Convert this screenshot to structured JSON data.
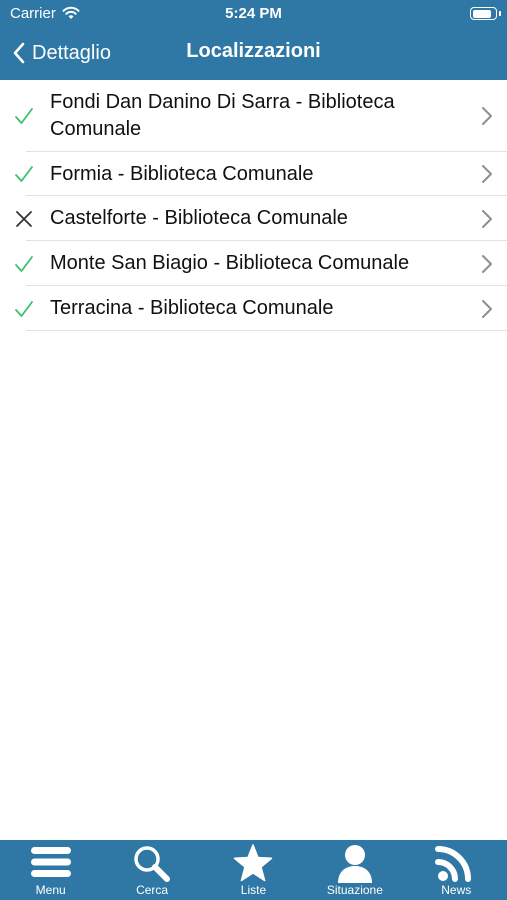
{
  "status_bar": {
    "carrier": "Carrier",
    "time": "5:24 PM",
    "battery_level": 0.9
  },
  "nav": {
    "back_label": "Dettaglio",
    "title": "Localizzazioni"
  },
  "locations": [
    {
      "name": "Fondi Dan Danino Di Sarra - Biblioteca Comunale",
      "status": "available",
      "status_icon": "check-icon"
    },
    {
      "name": "Formia - Biblioteca Comunale",
      "status": "available",
      "status_icon": "check-icon"
    },
    {
      "name": "Castelforte - Biblioteca Comunale",
      "status": "unavailable",
      "status_icon": "x-icon"
    },
    {
      "name": "Monte San Biagio - Biblioteca Comunale",
      "status": "available",
      "status_icon": "check-icon"
    },
    {
      "name": "Terracina - Biblioteca Comunale",
      "status": "available",
      "status_icon": "check-icon"
    }
  ],
  "tabbar": {
    "menu": "Menu",
    "cerca": "Cerca",
    "liste": "Liste",
    "situazione": "Situazione",
    "news": "News"
  },
  "colors": {
    "bar": "#2f77a4",
    "check": "#3cc26b",
    "cross": "#333333",
    "chevron": "#8e8e93"
  }
}
